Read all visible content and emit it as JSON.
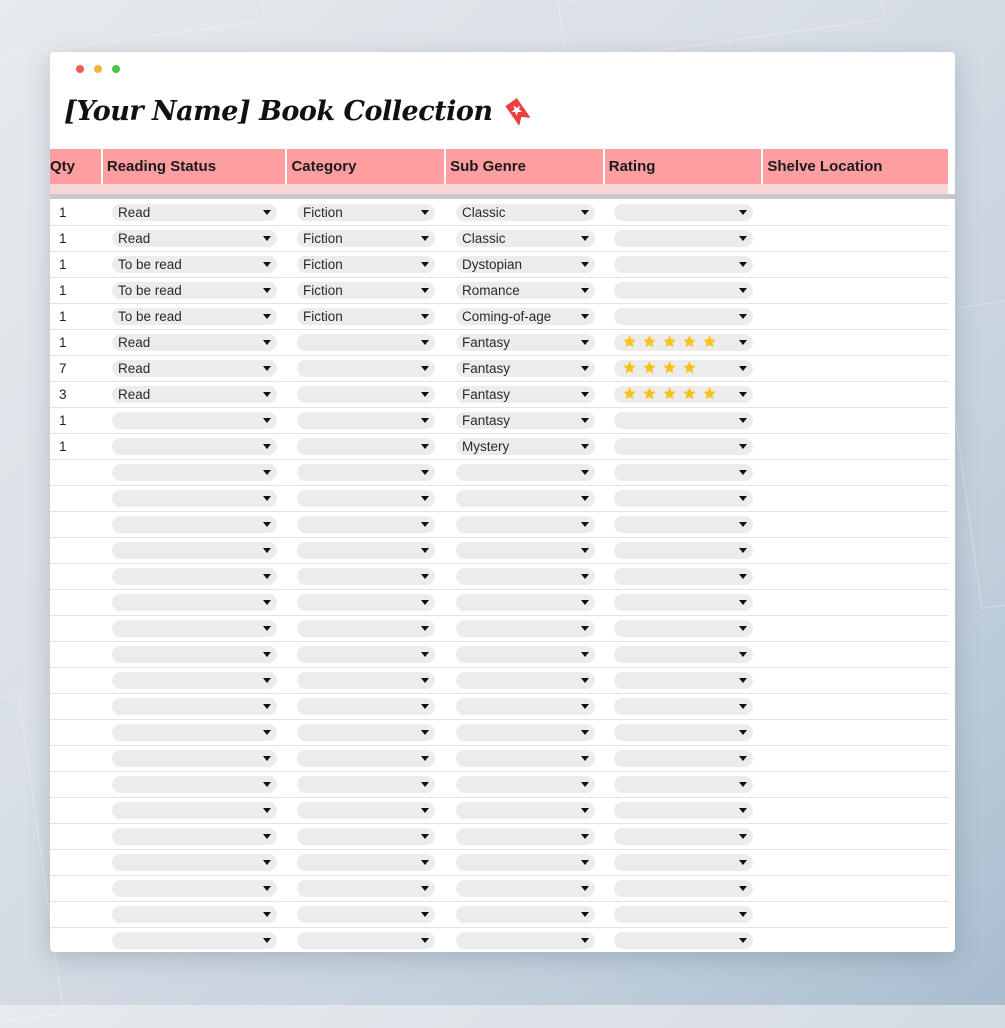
{
  "title": "[Your Name] Book Collection",
  "window_dots": [
    "#ec5b56",
    "#f2b53b",
    "#4fc046"
  ],
  "columns": [
    "Qty",
    "Reading Status",
    "Category",
    "Sub Genre",
    "Rating",
    "Shelve Location"
  ],
  "rows": [
    {
      "qty": "1",
      "status": "Read",
      "category": "Fiction",
      "subgenre": "Classic",
      "rating": 0
    },
    {
      "qty": "1",
      "status": "Read",
      "category": "Fiction",
      "subgenre": "Classic",
      "rating": 0
    },
    {
      "qty": "1",
      "status": "To be read",
      "category": "Fiction",
      "subgenre": "Dystopian",
      "rating": 0
    },
    {
      "qty": "1",
      "status": "To be read",
      "category": "Fiction",
      "subgenre": "Romance",
      "rating": 0
    },
    {
      "qty": "1",
      "status": "To be read",
      "category": "Fiction",
      "subgenre": "Coming-of-age",
      "rating": 0
    },
    {
      "qty": "1",
      "status": "Read",
      "category": "",
      "subgenre": "Fantasy",
      "rating": 5
    },
    {
      "qty": "7",
      "status": "Read",
      "category": "",
      "subgenre": "Fantasy",
      "rating": 4
    },
    {
      "qty": "3",
      "status": "Read",
      "category": "",
      "subgenre": "Fantasy",
      "rating": 5
    },
    {
      "qty": "1",
      "status": "",
      "category": "",
      "subgenre": "Fantasy",
      "rating": 0
    },
    {
      "qty": "1",
      "status": "",
      "category": "",
      "subgenre": "Mystery",
      "rating": 0
    },
    {
      "qty": "",
      "status": "",
      "category": "",
      "subgenre": "",
      "rating": 0
    },
    {
      "qty": "",
      "status": "",
      "category": "",
      "subgenre": "",
      "rating": 0
    },
    {
      "qty": "",
      "status": "",
      "category": "",
      "subgenre": "",
      "rating": 0
    },
    {
      "qty": "",
      "status": "",
      "category": "",
      "subgenre": "",
      "rating": 0
    },
    {
      "qty": "",
      "status": "",
      "category": "",
      "subgenre": "",
      "rating": 0
    },
    {
      "qty": "",
      "status": "",
      "category": "",
      "subgenre": "",
      "rating": 0
    },
    {
      "qty": "",
      "status": "",
      "category": "",
      "subgenre": "",
      "rating": 0
    },
    {
      "qty": "",
      "status": "",
      "category": "",
      "subgenre": "",
      "rating": 0
    },
    {
      "qty": "",
      "status": "",
      "category": "",
      "subgenre": "",
      "rating": 0
    },
    {
      "qty": "",
      "status": "",
      "category": "",
      "subgenre": "",
      "rating": 0
    },
    {
      "qty": "",
      "status": "",
      "category": "",
      "subgenre": "",
      "rating": 0
    },
    {
      "qty": "",
      "status": "",
      "category": "",
      "subgenre": "",
      "rating": 0
    },
    {
      "qty": "",
      "status": "",
      "category": "",
      "subgenre": "",
      "rating": 0
    },
    {
      "qty": "",
      "status": "",
      "category": "",
      "subgenre": "",
      "rating": 0
    },
    {
      "qty": "",
      "status": "",
      "category": "",
      "subgenre": "",
      "rating": 0
    },
    {
      "qty": "",
      "status": "",
      "category": "",
      "subgenre": "",
      "rating": 0
    },
    {
      "qty": "",
      "status": "",
      "category": "",
      "subgenre": "",
      "rating": 0
    },
    {
      "qty": "",
      "status": "",
      "category": "",
      "subgenre": "",
      "rating": 0
    },
    {
      "qty": "",
      "status": "",
      "category": "",
      "subgenre": "",
      "rating": 0
    },
    {
      "qty": "",
      "status": "",
      "category": "",
      "subgenre": "",
      "rating": 0
    },
    {
      "qty": "",
      "status": "",
      "category": "",
      "subgenre": "",
      "rating": 0
    }
  ],
  "colors": {
    "header_bg": "#ff9ea1",
    "subheader_bg": "#f7d6d6",
    "pill_bg": "#ececec",
    "star": "#f7c21a",
    "bookmark": "#e8403c"
  },
  "icons": {
    "title_icon": "bookmark-icon",
    "dropdown": "chevron-down-icon",
    "rating": "star-icon"
  }
}
